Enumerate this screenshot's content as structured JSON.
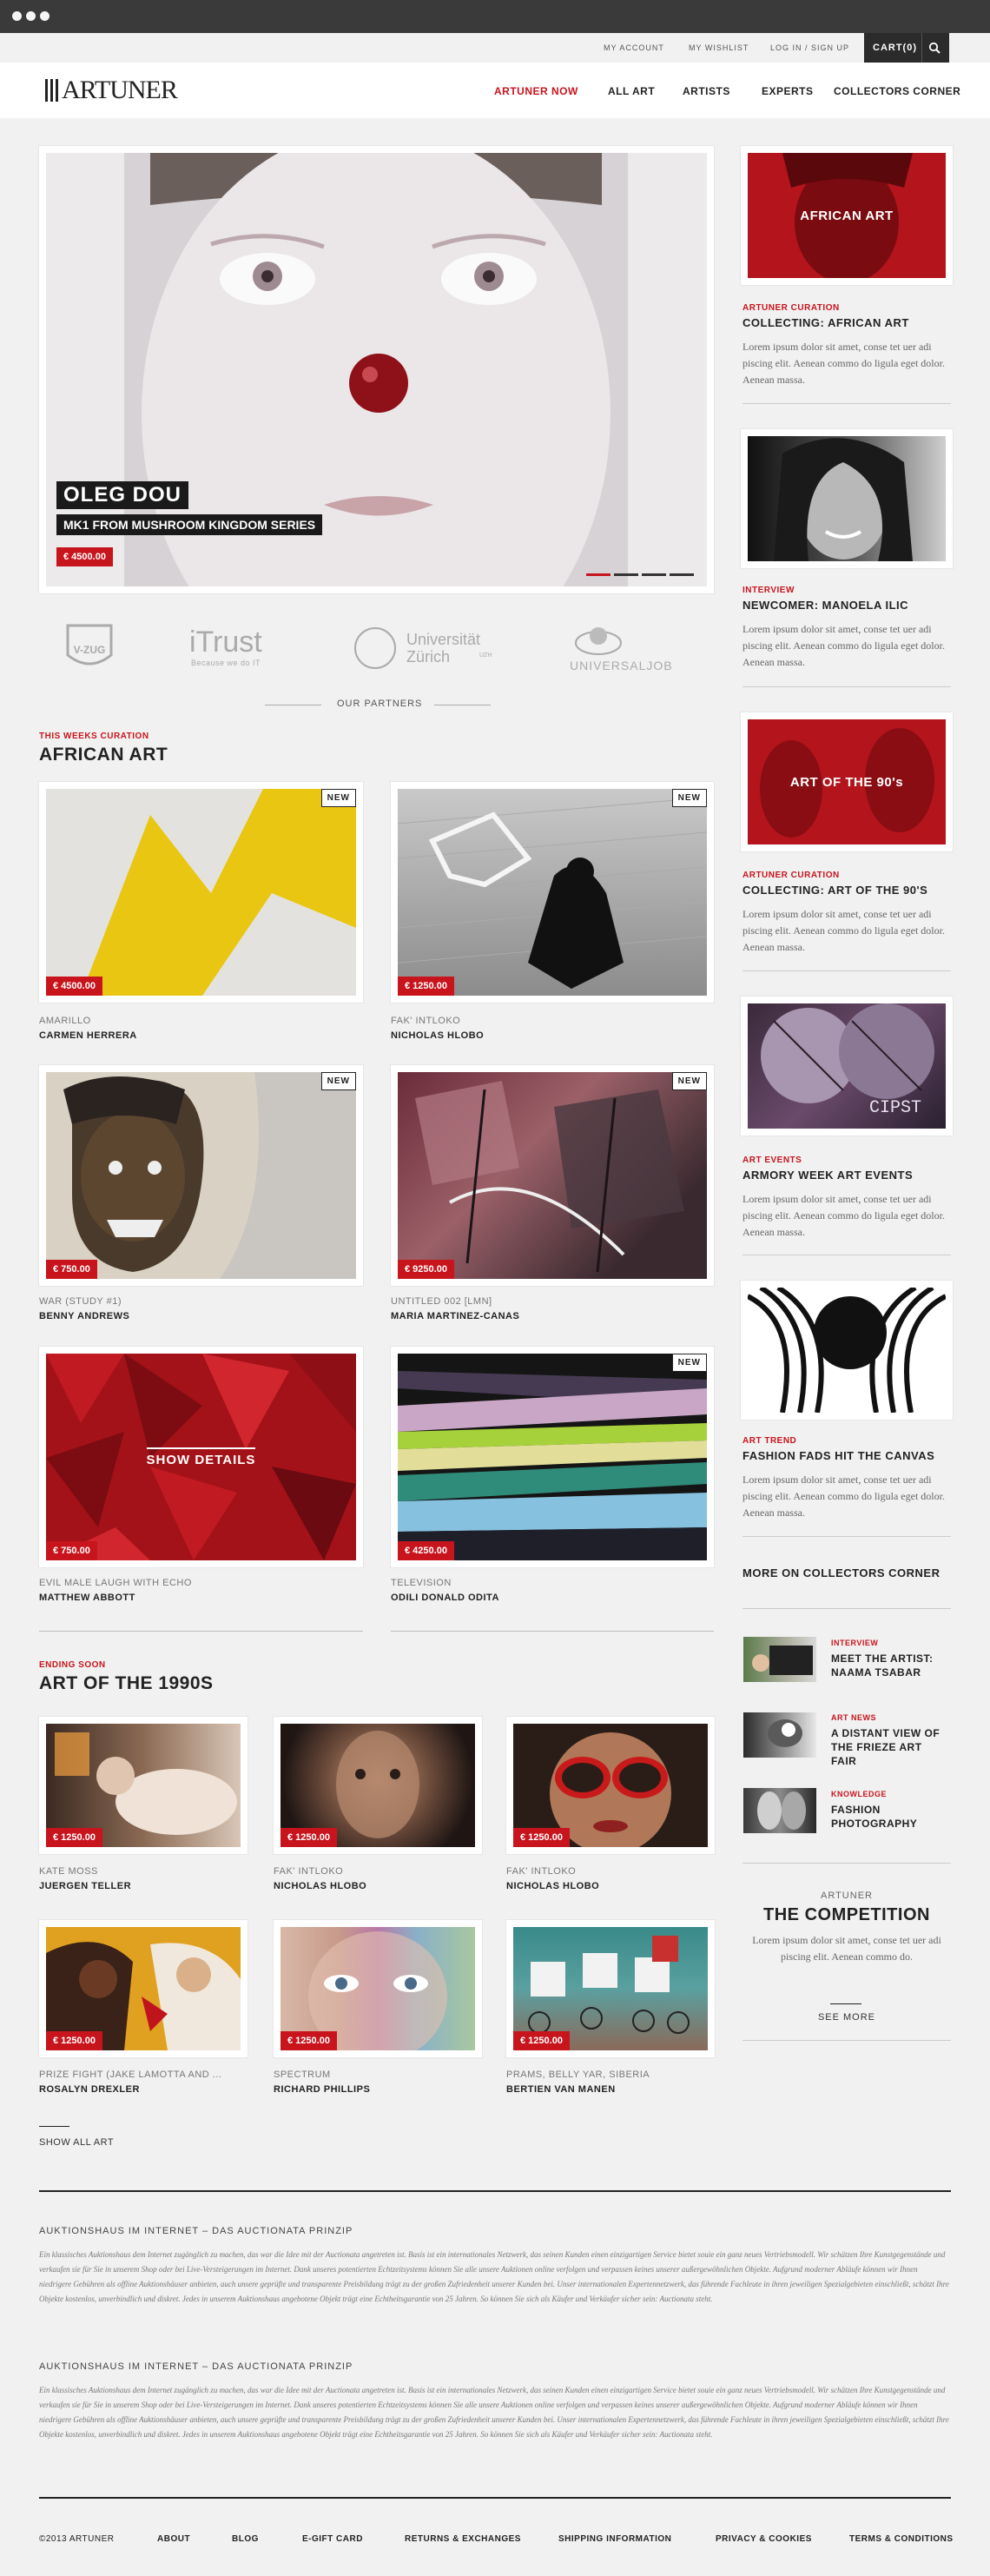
{
  "topbar": {
    "links": [
      "MY ACCOUNT",
      "MY WISHLIST",
      "LOG IN / SIGN UP"
    ],
    "cart_label": "CART(0)"
  },
  "header": {
    "logo": "ARTUNER",
    "nav": [
      "ARTUNER NOW",
      "ALL ART",
      "ARTISTS",
      "EXPERTS",
      "COLLECTORS CORNER"
    ]
  },
  "hero": {
    "artist": "OLEG DOU",
    "title": "MK1 FROM MUSHROOM KINGDOM SERIES",
    "price": "€ 4500.00"
  },
  "partners": {
    "label": "OUR PARTNERS",
    "logos": [
      "V-ZUG",
      "iTrust",
      "Universität Zürich",
      "UNIVERSALJOB"
    ],
    "itrust_tag": "Because we do IT",
    "uzh_suffix": "UZH"
  },
  "curation": {
    "kicker": "THIS WEEKS CURATION",
    "title": "AFRICAN ART",
    "items": [
      {
        "title": "AMARILLO",
        "artist": "CARMEN HERRERA",
        "price": "€ 4500.00",
        "badge": "NEW"
      },
      {
        "title": "FAK' INTLOKO",
        "artist": "NICHOLAS HLOBO",
        "price": "€ 1250.00",
        "badge": "NEW"
      },
      {
        "title": "WAR (STUDY #1)",
        "artist": "BENNY ANDREWS",
        "price": "€ 750.00",
        "badge": "NEW"
      },
      {
        "title": "UNTITLED 002 [LMN]",
        "artist": "MARIA MARTINEZ-CANAS",
        "price": "€ 9250.00",
        "badge": "NEW"
      },
      {
        "title": "EVIL MALE LAUGH WITH ECHO",
        "artist": "MATTHEW ABBOTT",
        "price": "€ 750.00",
        "overlay": "SHOW DETAILS"
      },
      {
        "title": "TELEVISION",
        "artist": "ODILI DONALD ODITA",
        "price": "€ 4250.00",
        "badge": "NEW"
      }
    ]
  },
  "ending": {
    "kicker": "ENDING SOON",
    "title": "ART OF THE 1990s",
    "items": [
      {
        "title": "KATE MOSS",
        "artist": "JUERGEN TELLER",
        "price": "€ 1250.00"
      },
      {
        "title": "FAK' INTLOKO",
        "artist": "NICHOLAS HLOBO",
        "price": "€ 1250.00"
      },
      {
        "title": "FAK' INTLOKO",
        "artist": "NICHOLAS HLOBO",
        "price": "€ 1250.00"
      },
      {
        "title": "PRIZE FIGHT (JAKE LAMOTTA AND ...",
        "artist": "ROSALYN DREXLER",
        "price": "€ 1250.00"
      },
      {
        "title": "SPECTRUM",
        "artist": "RICHARD PHILLIPS",
        "price": "€ 1250.00"
      },
      {
        "title": "PRAMS, BELLY YAR, SIBERIA",
        "artist": "BERTIEN VAN MANEN",
        "price": "€ 1250.00"
      }
    ],
    "show_all": "SHOW ALL ART"
  },
  "sidebar": {
    "features": [
      {
        "kicker": "ARTUNER CURATION",
        "title": "COLLECTING: AFRICAN ART",
        "image_label": "AFRICAN ART",
        "body": "Lorem ipsum dolor sit amet, conse tet uer adi piscing elit. Aenean commo do ligula eget dolor. Aenean massa."
      },
      {
        "kicker": "INTERVIEW",
        "title": "NEWCOMER: MANOELA ILIC",
        "body": "Lorem ipsum dolor sit amet, conse tet uer adi piscing elit. Aenean commo do ligula eget dolor. Aenean massa."
      },
      {
        "kicker": "ARTUNER CURATION",
        "title": "COLLECTING: ART OF THE 90's",
        "image_label": "ART OF THE 90's",
        "body": "Lorem ipsum dolor sit amet, conse tet uer adi piscing elit. Aenean commo do ligula eget dolor. Aenean massa."
      },
      {
        "kicker": "ART EVENTS",
        "title": "ARMORY WEEK ART EVENTS",
        "body": "Lorem ipsum dolor sit amet, conse tet uer adi piscing elit. Aenean commo do ligula eget dolor. Aenean massa."
      },
      {
        "kicker": "ART TREND",
        "title": "FASHION FADS HIT THE CANVAS",
        "body": "Lorem ipsum dolor sit amet, conse tet uer adi piscing elit. Aenean commo do ligula eget dolor. Aenean massa."
      }
    ],
    "more_title": "MORE ON COLLECTORS CORNER",
    "more": [
      {
        "kicker": "INTERVIEW",
        "title": "MEET THE ARTIST: NAAMA TSABAR"
      },
      {
        "kicker": "ART NEWS",
        "title": "A DISTANT VIEW OF THE FRIEZE ART FAIR"
      },
      {
        "kicker": "KNOWLEDGE",
        "title": "FASHION PHOTOGRAPHY"
      }
    ],
    "competition": {
      "kicker": "ARTUNER",
      "title": "THE COMPETITION",
      "body": "Lorem ipsum dolor sit amet, conse tet uer adi piscing elit. Aenean commo do.",
      "link": "SEE MORE"
    }
  },
  "footer": {
    "paragraphs": [
      {
        "title": "AUKTIONSHAUS IM INTERNET – DAS AUCTIONATA PRINZIP",
        "body": "Ein klassisches Auktionshaus dem Internet zugänglich zu machen, das war die Idee mit der Auctionata angetreten ist. Basis ist ein internationales Netzwerk, das seinen Kunden einen einzigartigen Service bietet souie ein ganz neues Vertriebsmodell. Wir schätzen Ihre Kunstgegenstände und verkaufen sie für Sie in unserem Shop oder bei Live-Versteigerungen im Internet. Dank unseres potentierten Echtzeitsystems können Sie alle unsere Auktionen online verfolgen und verpassen keines unserer außergewöhnlichen Objekte. Aufgrund moderner Abläufe können wir Ihnen niedrigere Gebühren als offline Auktionshäuser anbieten, auch unsere geprüfte und transparente Preisbildung trägt zu der großen Zufriedenheit unserer Kunden bei. Unser internationalen Expertennetzwerk, das führende Fachleute in ihren jeweiligen Spezialgebieten einschließt, schätzt Ihre Objekte kostenlos, unverbindlich und diskret. Jedes in unserem Auktionshaus angebotene Objekt trägt eine Echtheitsgarantie von 25 Jahren. So können Sie sich als Käufer und Verkäufer sicher sein: Auctionata steht."
      },
      {
        "title": "AUKTIONSHAUS IM INTERNET – DAS AUCTIONATA PRINZIP",
        "body": "Ein klassisches Auktionshaus dem Internet zugänglich zu machen, das war die Idee mit der Auctionata angetreten ist. Basis ist ein internationales Netzwerk, das seinen Kunden einen einzigartigen Service bietet souie ein ganz neues Vertriebsmodell. Wir schätzen Ihre Kunstgegenstände und verkaufen sie für Sie in unserem Shop oder bei Live-Versteigerungen im Internet. Dank unseres potentierten Echtzeitsystems können Sie alle unsere Auktionen online verfolgen und verpassen keines unserer außergewöhnlichen Objekte. Aufgrund moderner Abläufe können wir Ihnen niedrigere Gebühren als offline Auktionshäuser anbieten, auch unsere geprüfte und transparente Preisbildung trägt zu der großen Zufriedenheit unserer Kunden bei. Unser internationalen Expertennetzwerk, das führende Fachleute in ihren jeweiligen Spezialgebieten einschließt, schätzt Ihre Objekte kostenlos, unverbindlich und diskret. Jedes in unserem Auktionshaus angebotene Objekt trägt eine Echtheitsgarantie von 25 Jahren. So können Sie sich als Käufer und Verkäufer sicher sein: Auctionata steht."
      }
    ],
    "links": [
      "©2013 ARTUNER",
      "ABOUT",
      "BLOG",
      "E-GIFT CARD",
      "RETURNS & EXCHANGES",
      "SHIPPING INFORMATION",
      "PRIVACY & COOKIES",
      "TERMS & CONDITIONS"
    ]
  },
  "colors": {
    "accent": "#c8141c",
    "dark": "#2b2b2b",
    "background": "#f1f1f1"
  },
  "icons": [
    "search-icon",
    "logo-bars-icon"
  ]
}
